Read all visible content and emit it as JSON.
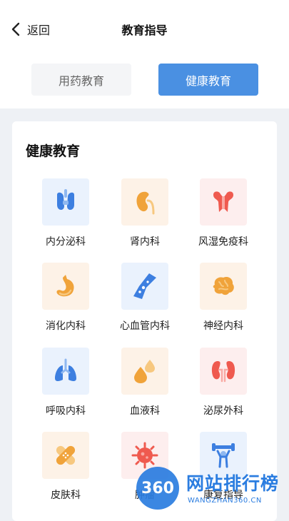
{
  "header": {
    "back_label": "返回",
    "title": "教育指导"
  },
  "tabs": [
    {
      "label": "用药教育",
      "active": false
    },
    {
      "label": "健康教育",
      "active": true
    }
  ],
  "section": {
    "title": "健康教育",
    "items": [
      {
        "label": "内分泌科",
        "icon": "thyroid-icon",
        "tint": "blue"
      },
      {
        "label": "肾内科",
        "icon": "kidney-icon",
        "tint": "orange"
      },
      {
        "label": "风湿免疫科",
        "icon": "bone-joint-icon",
        "tint": "red"
      },
      {
        "label": "消化内科",
        "icon": "stomach-icon",
        "tint": "orange"
      },
      {
        "label": "心血管内科",
        "icon": "blood-vessel-icon",
        "tint": "blue"
      },
      {
        "label": "神经内科",
        "icon": "brain-icon",
        "tint": "orange"
      },
      {
        "label": "呼吸内科",
        "icon": "lungs-icon",
        "tint": "blue"
      },
      {
        "label": "血液科",
        "icon": "blood-drops-icon",
        "tint": "orange"
      },
      {
        "label": "泌尿外科",
        "icon": "kidneys-icon",
        "tint": "red"
      },
      {
        "label": "皮肤科",
        "icon": "bandage-icon",
        "tint": "orange"
      },
      {
        "label": "肿瘤",
        "icon": "virus-cell-icon",
        "tint": "red"
      },
      {
        "label": "康复指导",
        "icon": "dumbbell-icon",
        "tint": "blue"
      }
    ]
  },
  "watermark": {
    "logo_text": "360",
    "brand": "网站排行榜",
    "url": "WANGZHAN360.CN"
  },
  "colors": {
    "accent": "#4a90e2",
    "background": "#eef1f5",
    "orange": "#f0a33a",
    "blue": "#3d7fe0",
    "red": "#ef5a4f"
  }
}
